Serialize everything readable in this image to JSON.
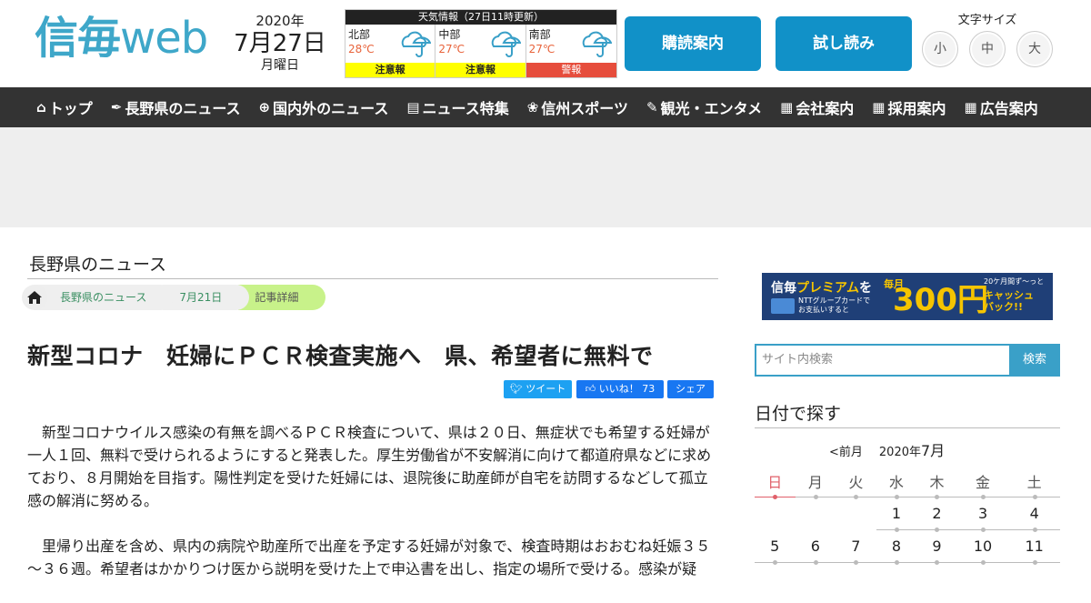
{
  "header": {
    "logo": {
      "kanji": "信毎",
      "latin": "web"
    },
    "date": {
      "year": "2020年",
      "month_day": "7月27日",
      "weekday": "月曜日"
    },
    "weather": {
      "title": "天気情報（27日11時更新）",
      "regions": [
        {
          "name": "北部",
          "temp": "28℃",
          "icon": "umbrella-cloud-icon",
          "alert": "注意報",
          "alert_color": "#ffff00"
        },
        {
          "name": "中部",
          "temp": "27℃",
          "icon": "umbrella-cloud-icon",
          "alert": "注意報",
          "alert_color": "#ffff00"
        },
        {
          "name": "南部",
          "temp": "27℃",
          "icon": "umbrella-cloud-icon",
          "alert": "警報",
          "alert_color": "#e64d3c"
        }
      ]
    },
    "subscribe_label": "購読案内",
    "trial_label": "試し読み",
    "font_size": {
      "label": "文字サイズ",
      "small": "小",
      "medium": "中",
      "large": "大"
    }
  },
  "nav": {
    "items": [
      {
        "icon": "home-icon",
        "label": "トップ"
      },
      {
        "icon": "pen-icon",
        "label": "長野県のニュース"
      },
      {
        "icon": "globe-icon",
        "label": "国内外のニュース"
      },
      {
        "icon": "document-icon",
        "label": "ニュース特集"
      },
      {
        "icon": "balls-icon",
        "label": "信州スポーツ"
      },
      {
        "icon": "wrench-icon",
        "label": "観光・エンタメ"
      },
      {
        "icon": "list-icon",
        "label": "会社案内"
      },
      {
        "icon": "list-icon",
        "label": "採用案内"
      },
      {
        "icon": "list-icon",
        "label": "広告案内"
      }
    ]
  },
  "main": {
    "section_title": "長野県のニュース",
    "breadcrumb": {
      "home_icon": "home-icon",
      "items": [
        "長野県のニュース",
        "7月21日",
        "記事詳細"
      ]
    },
    "headline": "新型コロナ　妊婦にＰＣＲ検査実施へ　県、希望者に無料で",
    "share": {
      "tweet": "ツイート",
      "like": "いいね！ 73",
      "share": "シェア"
    },
    "paragraphs": [
      "新型コロナウイルス感染の有無を調べるＰＣＲ検査について、県は２０日、無症状でも希望する妊婦が一人１回、無料で受けられるようにすると発表した。厚生労働省が不安解消に向けて都道府県などに求めており、８月開始を目指す。陽性判定を受けた妊婦には、退院後に助産師が自宅を訪問するなどして孤立感の解消に努める。",
      "里帰り出産を含め、県内の病院や助産所で出産を予定する妊婦が対象で、検査時期はおおむね妊娠３５～３６週。希望者はかかりつけ医から説明を受けた上で申込書を出し、指定の場所で受ける。感染が疑"
    ]
  },
  "sidebar": {
    "banner": {
      "brand": "信毎",
      "premium": "プレミアム",
      "wo": "を",
      "line1": "NTTグループカードで",
      "line2": "お支払いすると",
      "every_month": "毎月",
      "amount": "300円",
      "months": "20ケ月間ず〜っと",
      "cashback1": "キャッシュ",
      "cashback2": "バック!!"
    },
    "search": {
      "placeholder": "サイト内検索",
      "button": "検索"
    },
    "calendar": {
      "title": "日付で探す",
      "prev": "<前月",
      "year": "2020年",
      "month": "7月",
      "weekdays": [
        "日",
        "月",
        "火",
        "水",
        "木",
        "金",
        "土"
      ],
      "weeks": [
        [
          "",
          "",
          "",
          "1",
          "2",
          "3",
          "4"
        ],
        [
          "5",
          "6",
          "7",
          "8",
          "9",
          "10",
          "11"
        ]
      ]
    }
  }
}
